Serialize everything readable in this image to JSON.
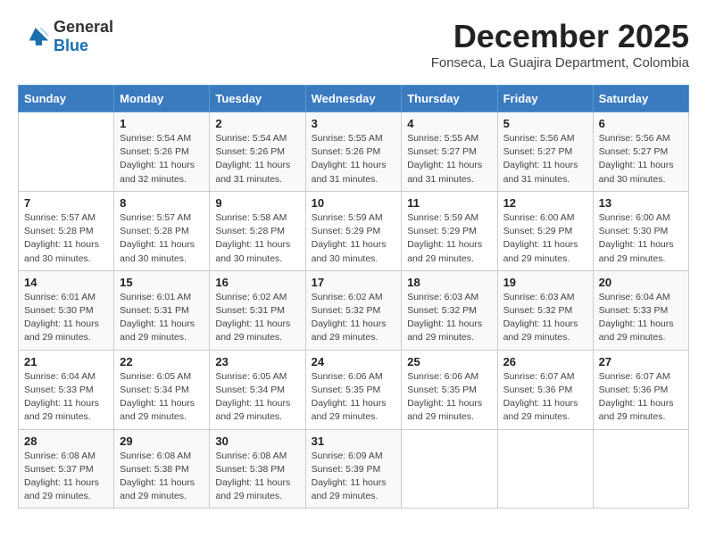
{
  "logo": {
    "general": "General",
    "blue": "Blue"
  },
  "title": "December 2025",
  "subtitle": "Fonseca, La Guajira Department, Colombia",
  "days_header": [
    "Sunday",
    "Monday",
    "Tuesday",
    "Wednesday",
    "Thursday",
    "Friday",
    "Saturday"
  ],
  "weeks": [
    [
      {
        "day": "",
        "info": ""
      },
      {
        "day": "1",
        "info": "Sunrise: 5:54 AM\nSunset: 5:26 PM\nDaylight: 11 hours\nand 32 minutes."
      },
      {
        "day": "2",
        "info": "Sunrise: 5:54 AM\nSunset: 5:26 PM\nDaylight: 11 hours\nand 31 minutes."
      },
      {
        "day": "3",
        "info": "Sunrise: 5:55 AM\nSunset: 5:26 PM\nDaylight: 11 hours\nand 31 minutes."
      },
      {
        "day": "4",
        "info": "Sunrise: 5:55 AM\nSunset: 5:27 PM\nDaylight: 11 hours\nand 31 minutes."
      },
      {
        "day": "5",
        "info": "Sunrise: 5:56 AM\nSunset: 5:27 PM\nDaylight: 11 hours\nand 31 minutes."
      },
      {
        "day": "6",
        "info": "Sunrise: 5:56 AM\nSunset: 5:27 PM\nDaylight: 11 hours\nand 30 minutes."
      }
    ],
    [
      {
        "day": "7",
        "info": "Sunrise: 5:57 AM\nSunset: 5:28 PM\nDaylight: 11 hours\nand 30 minutes."
      },
      {
        "day": "8",
        "info": "Sunrise: 5:57 AM\nSunset: 5:28 PM\nDaylight: 11 hours\nand 30 minutes."
      },
      {
        "day": "9",
        "info": "Sunrise: 5:58 AM\nSunset: 5:28 PM\nDaylight: 11 hours\nand 30 minutes."
      },
      {
        "day": "10",
        "info": "Sunrise: 5:59 AM\nSunset: 5:29 PM\nDaylight: 11 hours\nand 30 minutes."
      },
      {
        "day": "11",
        "info": "Sunrise: 5:59 AM\nSunset: 5:29 PM\nDaylight: 11 hours\nand 29 minutes."
      },
      {
        "day": "12",
        "info": "Sunrise: 6:00 AM\nSunset: 5:29 PM\nDaylight: 11 hours\nand 29 minutes."
      },
      {
        "day": "13",
        "info": "Sunrise: 6:00 AM\nSunset: 5:30 PM\nDaylight: 11 hours\nand 29 minutes."
      }
    ],
    [
      {
        "day": "14",
        "info": "Sunrise: 6:01 AM\nSunset: 5:30 PM\nDaylight: 11 hours\nand 29 minutes."
      },
      {
        "day": "15",
        "info": "Sunrise: 6:01 AM\nSunset: 5:31 PM\nDaylight: 11 hours\nand 29 minutes."
      },
      {
        "day": "16",
        "info": "Sunrise: 6:02 AM\nSunset: 5:31 PM\nDaylight: 11 hours\nand 29 minutes."
      },
      {
        "day": "17",
        "info": "Sunrise: 6:02 AM\nSunset: 5:32 PM\nDaylight: 11 hours\nand 29 minutes."
      },
      {
        "day": "18",
        "info": "Sunrise: 6:03 AM\nSunset: 5:32 PM\nDaylight: 11 hours\nand 29 minutes."
      },
      {
        "day": "19",
        "info": "Sunrise: 6:03 AM\nSunset: 5:32 PM\nDaylight: 11 hours\nand 29 minutes."
      },
      {
        "day": "20",
        "info": "Sunrise: 6:04 AM\nSunset: 5:33 PM\nDaylight: 11 hours\nand 29 minutes."
      }
    ],
    [
      {
        "day": "21",
        "info": "Sunrise: 6:04 AM\nSunset: 5:33 PM\nDaylight: 11 hours\nand 29 minutes."
      },
      {
        "day": "22",
        "info": "Sunrise: 6:05 AM\nSunset: 5:34 PM\nDaylight: 11 hours\nand 29 minutes."
      },
      {
        "day": "23",
        "info": "Sunrise: 6:05 AM\nSunset: 5:34 PM\nDaylight: 11 hours\nand 29 minutes."
      },
      {
        "day": "24",
        "info": "Sunrise: 6:06 AM\nSunset: 5:35 PM\nDaylight: 11 hours\nand 29 minutes."
      },
      {
        "day": "25",
        "info": "Sunrise: 6:06 AM\nSunset: 5:35 PM\nDaylight: 11 hours\nand 29 minutes."
      },
      {
        "day": "26",
        "info": "Sunrise: 6:07 AM\nSunset: 5:36 PM\nDaylight: 11 hours\nand 29 minutes."
      },
      {
        "day": "27",
        "info": "Sunrise: 6:07 AM\nSunset: 5:36 PM\nDaylight: 11 hours\nand 29 minutes."
      }
    ],
    [
      {
        "day": "28",
        "info": "Sunrise: 6:08 AM\nSunset: 5:37 PM\nDaylight: 11 hours\nand 29 minutes."
      },
      {
        "day": "29",
        "info": "Sunrise: 6:08 AM\nSunset: 5:38 PM\nDaylight: 11 hours\nand 29 minutes."
      },
      {
        "day": "30",
        "info": "Sunrise: 6:08 AM\nSunset: 5:38 PM\nDaylight: 11 hours\nand 29 minutes."
      },
      {
        "day": "31",
        "info": "Sunrise: 6:09 AM\nSunset: 5:39 PM\nDaylight: 11 hours\nand 29 minutes."
      },
      {
        "day": "",
        "info": ""
      },
      {
        "day": "",
        "info": ""
      },
      {
        "day": "",
        "info": ""
      }
    ]
  ]
}
